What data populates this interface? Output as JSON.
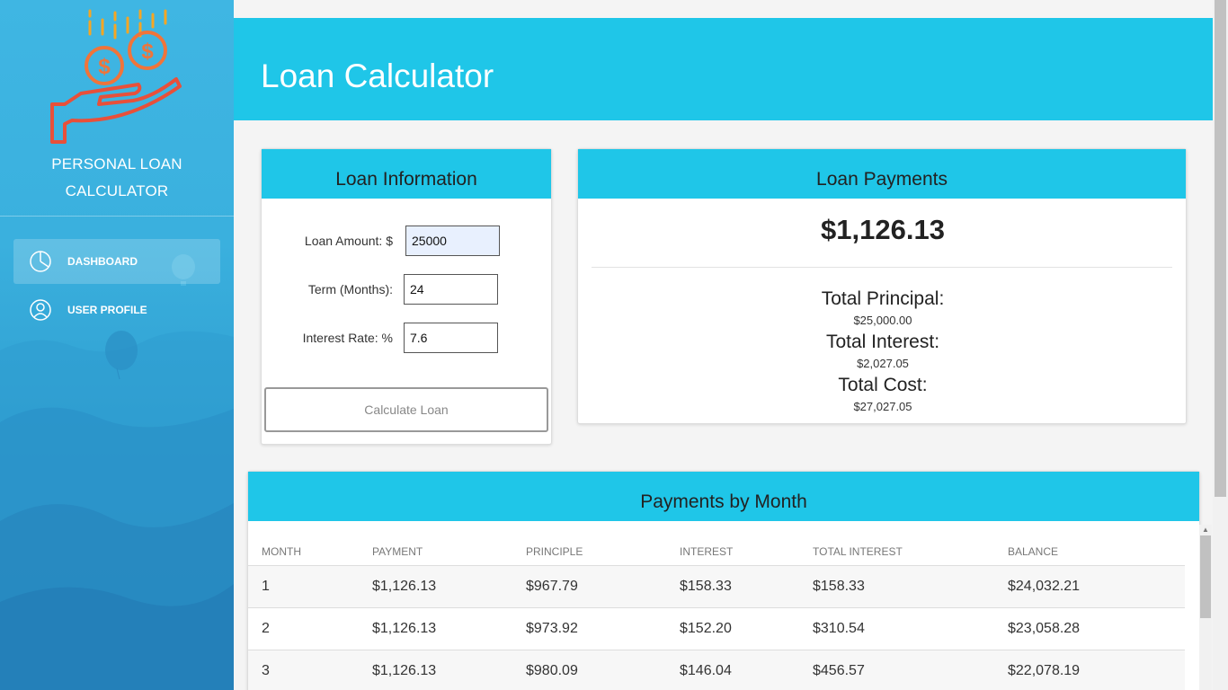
{
  "sidebar": {
    "brand_line1": "PERSONAL LOAN",
    "brand_line2": "CALCULATOR",
    "items": [
      {
        "label": "DASHBOARD",
        "icon": "pie-chart-icon",
        "active": true
      },
      {
        "label": "USER PROFILE",
        "icon": "user-icon",
        "active": false
      }
    ]
  },
  "header": {
    "title": "Loan Calculator"
  },
  "loan_info": {
    "title": "Loan Information",
    "amount_label": "Loan Amount: $",
    "amount_value": "25000",
    "term_label": "Term (Months):",
    "term_value": "24",
    "rate_label": "Interest Rate: %",
    "rate_value": "7.6",
    "button_label": "Calculate Loan"
  },
  "loan_payments": {
    "title": "Loan Payments",
    "monthly_payment": "$1,126.13",
    "principal_label": "Total Principal:",
    "principal_value": "$25,000.00",
    "interest_label": "Total Interest:",
    "interest_value": "$2,027.05",
    "cost_label": "Total Cost:",
    "cost_value": "$27,027.05"
  },
  "payments_table": {
    "title": "Payments by Month",
    "columns": [
      "MONTH",
      "PAYMENT",
      "PRINCIPLE",
      "INTEREST",
      "TOTAL INTEREST",
      "BALANCE"
    ],
    "rows": [
      [
        "1",
        "$1,126.13",
        "$967.79",
        "$158.33",
        "$158.33",
        "$24,032.21"
      ],
      [
        "2",
        "$1,126.13",
        "$973.92",
        "$152.20",
        "$310.54",
        "$23,058.28"
      ],
      [
        "3",
        "$1,126.13",
        "$980.09",
        "$146.04",
        "$456.57",
        "$22,078.19"
      ]
    ]
  },
  "colors": {
    "accent": "#1fc6e8",
    "logo": "#f0743a",
    "logo_gold": "#f6a623",
    "sidebar": "#3ab0de"
  }
}
